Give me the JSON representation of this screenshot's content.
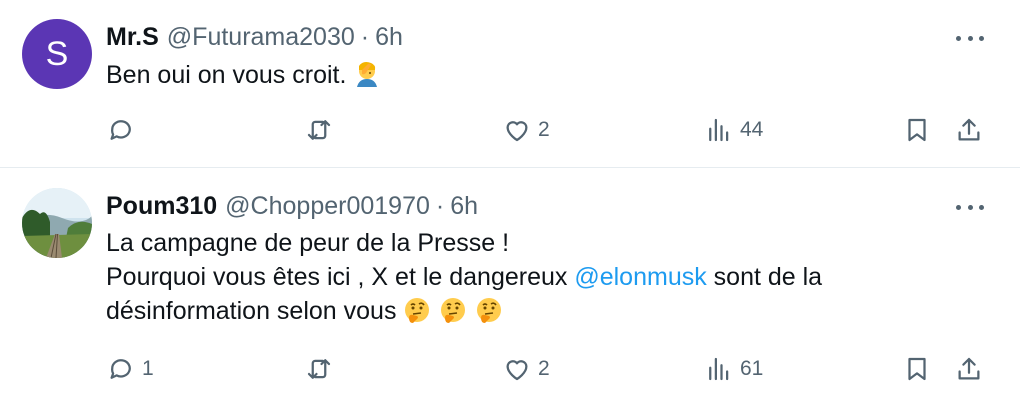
{
  "tweets": [
    {
      "avatar_letter": "S",
      "avatar_color": "#5b36b4",
      "name": "Mr.S",
      "handle": "@Futurama2030",
      "dot": "·",
      "time": "6h",
      "text": "Ben oui on vous croit.",
      "emoji": "facepalm-emoji",
      "replies": "",
      "likes": "2",
      "views": "44"
    },
    {
      "avatar_image": "landscape-photo",
      "name": "Poum310",
      "handle": "@Chopper001970",
      "dot": "·",
      "time": "6h",
      "line1": "La campagne de peur de la Presse !",
      "line2_before": "Pourquoi vous êtes ici ,  X et le dangereux ",
      "mention": "@elonmusk",
      "line2_after": " sont de la",
      "line3": "désinformation selon vous ",
      "emojis": [
        "thinking-emoji",
        "thinking-emoji",
        "thinking-emoji"
      ],
      "replies": "1",
      "likes": "2",
      "views": "61"
    }
  ],
  "colors": {
    "link": "#1d9bf0",
    "muted": "#536471",
    "text": "#0f1419"
  }
}
